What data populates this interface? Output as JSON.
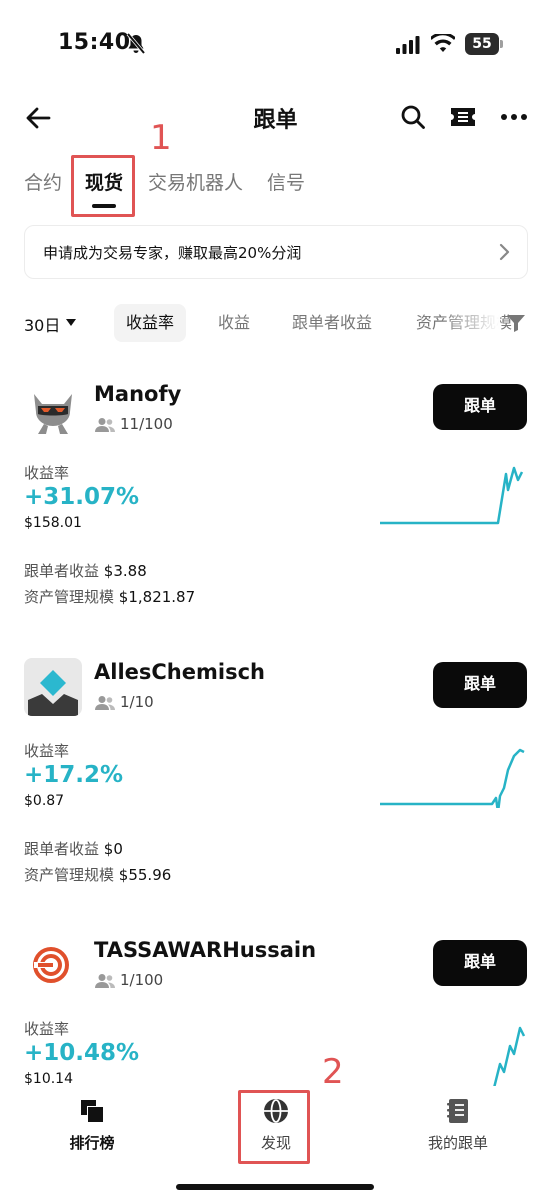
{
  "status": {
    "time": "15:40",
    "battery": "55"
  },
  "header": {
    "title": "跟单"
  },
  "tabs": [
    {
      "label": "合约",
      "active": false
    },
    {
      "label": "现货",
      "active": true
    },
    {
      "label": "交易机器人",
      "active": false
    },
    {
      "label": "信号",
      "active": false
    }
  ],
  "annotations": {
    "one": "1",
    "two": "2",
    "color": "#e05454"
  },
  "banner": {
    "text": "申请成为交易专家，赚取最高20%分润"
  },
  "filters": {
    "period": "30日",
    "chips": [
      "收益率",
      "收益",
      "跟单者收益",
      "资产管理规模"
    ]
  },
  "traders": [
    {
      "name": "Manofy",
      "followers": "11/100",
      "follow_label": "跟单",
      "roi_label": "收益率",
      "roi": "+31.07%",
      "pnl": "$158.01",
      "copier_pnl_label": "跟单者收益",
      "copier_pnl": "$3.88",
      "aum_label": "资产管理规模",
      "aum": "$1,821.87"
    },
    {
      "name": "AllesChemisch",
      "followers": "1/10",
      "follow_label": "跟单",
      "roi_label": "收益率",
      "roi": "+17.2%",
      "pnl": "$0.87",
      "copier_pnl_label": "跟单者收益",
      "copier_pnl": "$0",
      "aum_label": "资产管理规模",
      "aum": "$55.96"
    },
    {
      "name": "TASSAWARHussain",
      "followers": "1/100",
      "follow_label": "跟单",
      "roi_label": "收益率",
      "roi": "+10.48%",
      "pnl": "$10.14"
    }
  ],
  "bottom_nav": [
    {
      "label": "排行榜",
      "icon": "leaderboard-icon",
      "active": true
    },
    {
      "label": "发现",
      "icon": "globe-icon",
      "active": false
    },
    {
      "label": "我的跟单",
      "icon": "notebook-icon",
      "active": false
    }
  ],
  "colors": {
    "accent": "#27b3c6",
    "button": "#0a0a0a",
    "annotation": "#e05454"
  }
}
